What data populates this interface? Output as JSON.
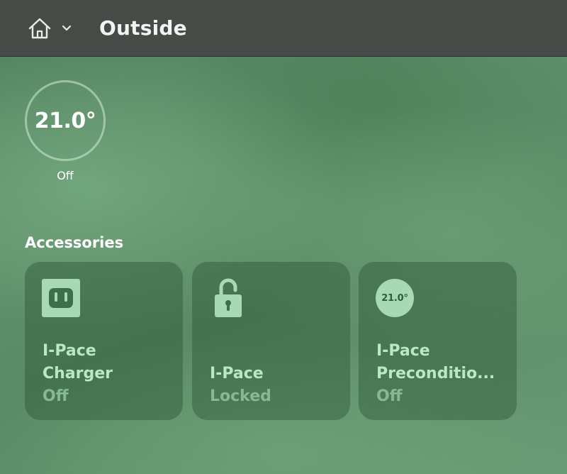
{
  "header": {
    "home_icon": "home-icon",
    "dropdown_icon": "chevron-down-icon",
    "title": "Outside"
  },
  "thermostat": {
    "temperature": "21.0°",
    "status": "Off"
  },
  "accessories": {
    "section_title": "Accessories",
    "items": [
      {
        "icon": "outlet-icon",
        "name_line1": "I-Pace",
        "name_line2": "Charger",
        "status": "Off"
      },
      {
        "icon": "lock-icon",
        "name_line1": "I-Pace",
        "status": "Locked"
      },
      {
        "icon": "thermostat-badge-icon",
        "badge": "21.0°",
        "name_line1": "I-Pace",
        "name_line2": "Preconditio...",
        "status": "Off"
      }
    ]
  },
  "colors": {
    "topbar": "#474b48",
    "tile_text": "#b9e8c3",
    "tile_status": "#86b893",
    "badge_bg": "#a7dab2"
  }
}
